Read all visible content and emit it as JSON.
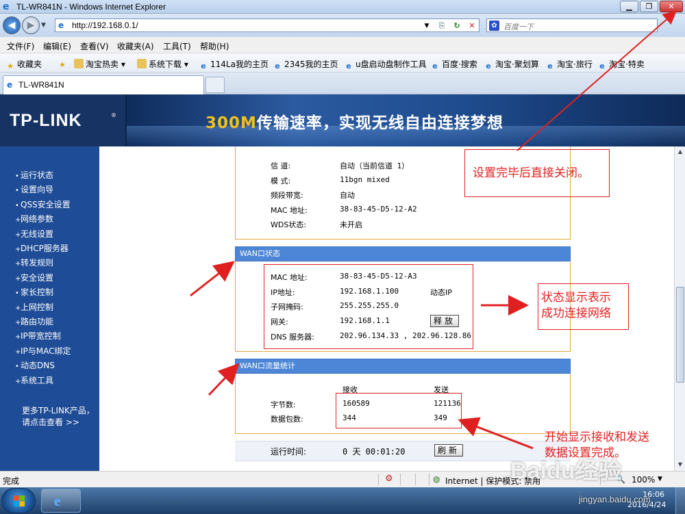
{
  "window": {
    "title": "TL-WR841N - Windows Internet Explorer",
    "buttons": {
      "minimize": "▁",
      "maximize": "❐",
      "close": "✕"
    }
  },
  "address": {
    "url": "http://192.168.0.1/",
    "search_placeholder": "百度一下"
  },
  "menu": [
    "文件(F)",
    "编辑(E)",
    "查看(V)",
    "收藏夹(A)",
    "工具(T)",
    "帮助(H)"
  ],
  "favorites": {
    "label": "收藏夹",
    "items": [
      "淘宝热卖",
      "系统下载",
      "114La我的主页",
      "2345我的主页",
      "u盘启动盘制作工具",
      "百度·搜索",
      "淘宝·聚划算",
      "淘宝·旅行",
      "淘宝·特卖"
    ]
  },
  "tab": {
    "label": "TL-WR841N"
  },
  "banner": {
    "logo": "TP-LINK",
    "reg": "®",
    "slogan_highlight": "300M",
    "slogan_rest": "传输速率，实现无线自由连接梦想"
  },
  "sidebar": {
    "items": [
      {
        "bullet": "•",
        "label": "运行状态"
      },
      {
        "bullet": "•",
        "label": "设置向导"
      },
      {
        "bullet": "•",
        "label": "QSS安全设置"
      },
      {
        "bullet": "+",
        "label": "网络参数"
      },
      {
        "bullet": "+",
        "label": "无线设置"
      },
      {
        "bullet": "+",
        "label": "DHCP服务器"
      },
      {
        "bullet": "+",
        "label": "转发规则"
      },
      {
        "bullet": "+",
        "label": "安全设置"
      },
      {
        "bullet": "•",
        "label": "家长控制"
      },
      {
        "bullet": "+",
        "label": "上网控制"
      },
      {
        "bullet": "+",
        "label": "路由功能"
      },
      {
        "bullet": "+",
        "label": "IP带宽控制"
      },
      {
        "bullet": "+",
        "label": "IP与MAC绑定"
      },
      {
        "bullet": "•",
        "label": "动态DNS"
      },
      {
        "bullet": "+",
        "label": "系统工具"
      }
    ],
    "more_line1": "更多TP-LINK产品，",
    "more_line2": "请点击查看 >>"
  },
  "wireless": {
    "rows": [
      {
        "label": "信  道:",
        "value": "自动（当前信道 1）"
      },
      {
        "label": "模  式:",
        "value": "11bgn mixed"
      },
      {
        "label": "频段带宽:",
        "value": "自动"
      },
      {
        "label": "MAC 地址:",
        "value": "38-83-45-D5-12-A2"
      },
      {
        "label": "WDS状态:",
        "value": "未开启"
      }
    ]
  },
  "wan": {
    "title": "WAN口状态",
    "mac_label": "MAC 地址:",
    "mac": "38-83-45-D5-12-A3",
    "ip_label": "IP地址:",
    "ip": "192.168.1.100",
    "ip_type": "动态IP",
    "mask_label": "子网掩码:",
    "mask": "255.255.255.0",
    "gw_label": "网关:",
    "gw": "192.168.1.1",
    "release_button": "释放",
    "dns_label": "DNS 服务器:",
    "dns": "202.96.134.33 , 202.96.128.86"
  },
  "traffic": {
    "title": "WAN口流量统计",
    "col_recv": "接收",
    "col_send": "发送",
    "bytes_label": "字节数:",
    "bytes_recv": "160589",
    "bytes_send": "121136",
    "packets_label": "数据包数:",
    "packets_recv": "344",
    "packets_send": "349"
  },
  "uptime": {
    "label": "运行时间:",
    "value": "0 天 00:01:20",
    "refresh_button": "刷新"
  },
  "annotations": {
    "close_note": "设置完毕后直接关闭。",
    "status_note_1": "状态显示表示",
    "status_note_2": "成功连接网络",
    "traffic_note_1": "开始显示接收和发送",
    "traffic_note_2": "数据设置完成。"
  },
  "statusbar": {
    "left": "完成",
    "zone": "Internet | 保护模式: 禁用",
    "zoom": "100%"
  },
  "taskbar": {
    "time": "16:06",
    "date": "2016/4/24"
  },
  "watermark": {
    "main": "Baidu经验",
    "sub": "jingyan.baidu.com"
  },
  "colors": {
    "accent_red": "#e02020",
    "panel_border": "#e3a73c",
    "panel_head": "#4d86d6",
    "sidebar": "#1f4c96"
  }
}
